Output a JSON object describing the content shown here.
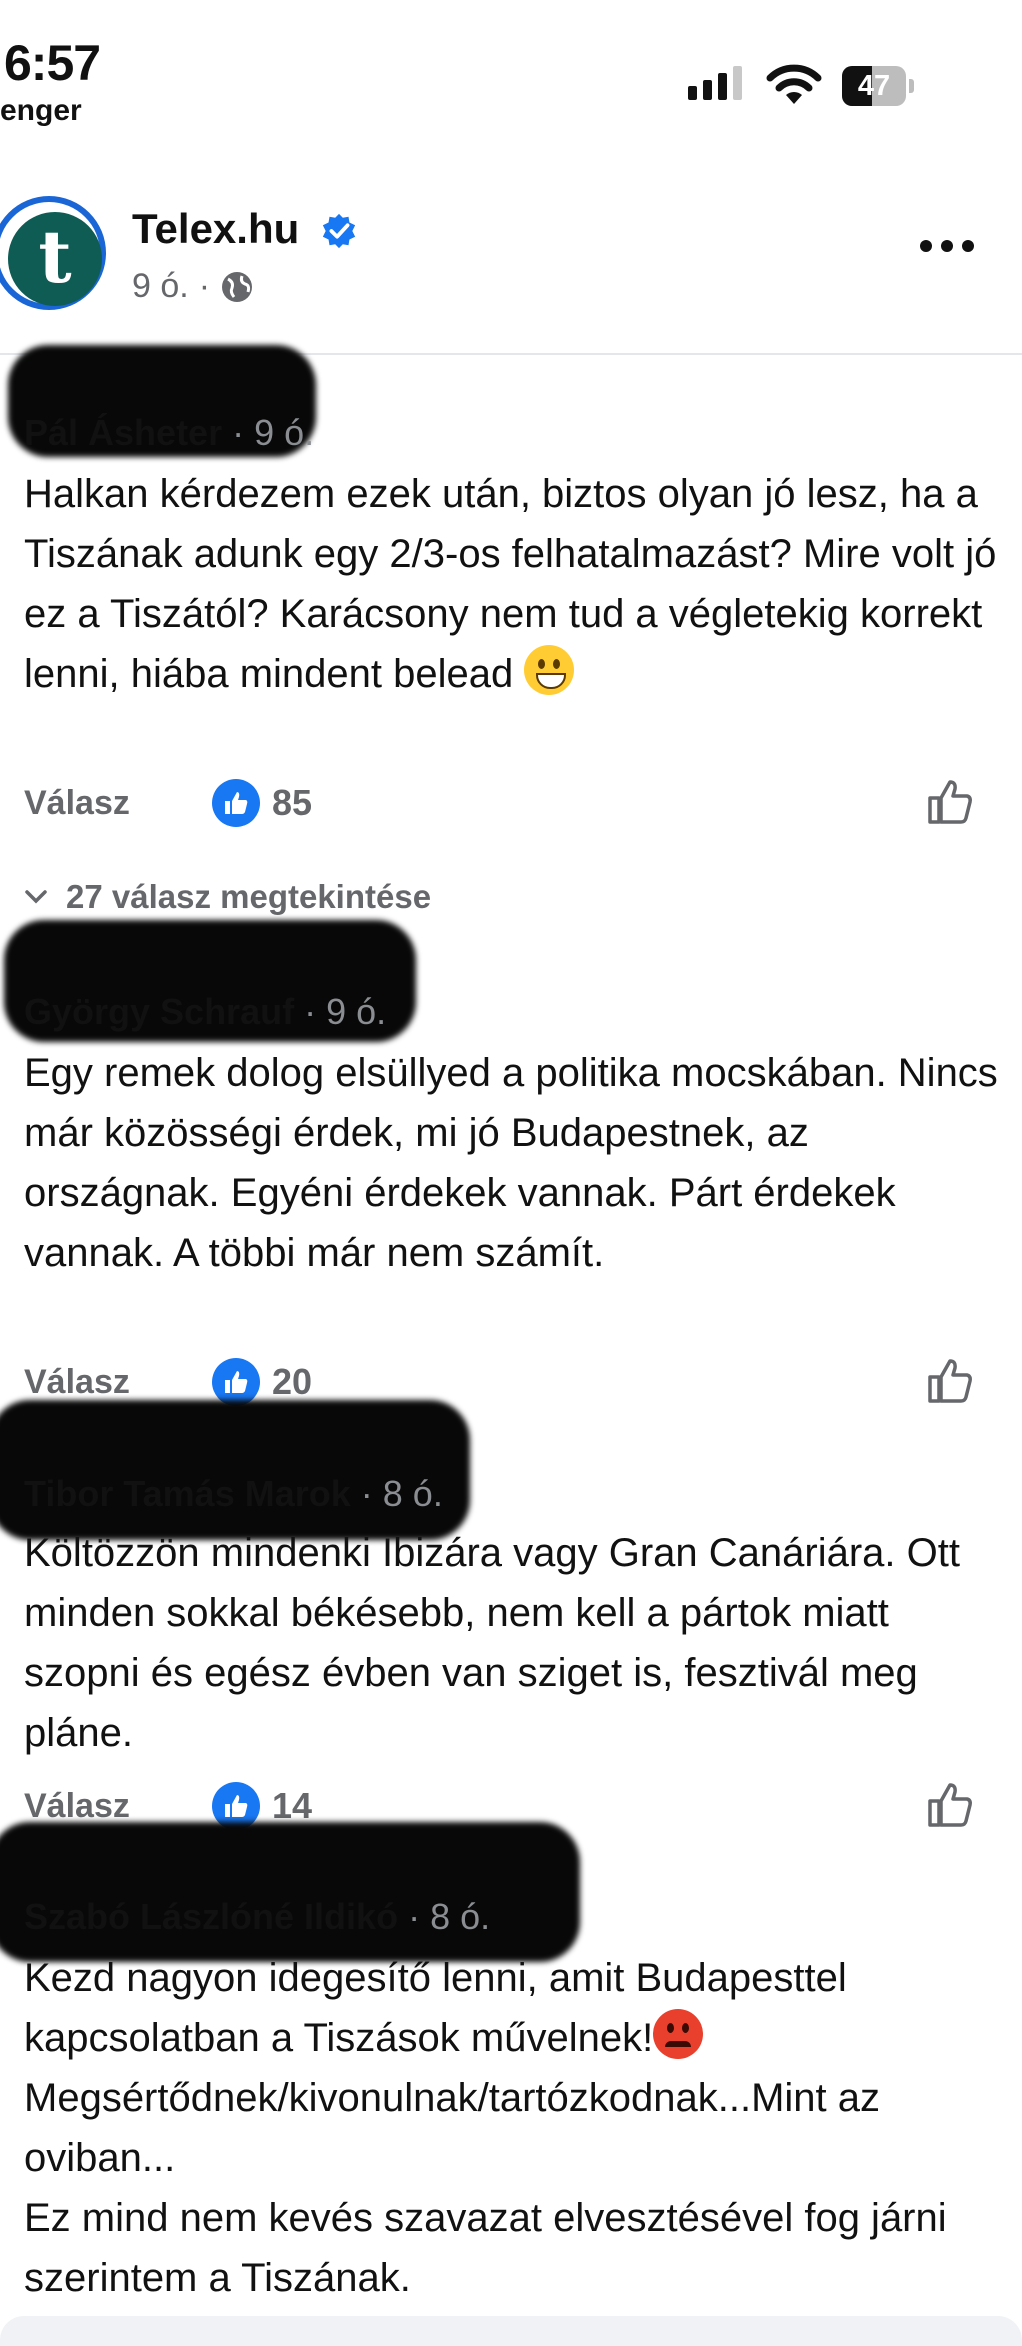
{
  "status_bar": {
    "time": "6:57",
    "back_app": "enger",
    "battery": "47",
    "battery_level": 0.47,
    "signal_bars_active": 3
  },
  "post": {
    "page_name": "Telex.hu",
    "avatar_letter": "t",
    "time": "9 ó.",
    "separator": "·",
    "audience_icon": "globe-icon",
    "verified_icon": "verified-badge-icon",
    "more_icon": "more-dots-icon"
  },
  "comments": [
    {
      "author": "Pál Ásheter",
      "time": "· 9 ó.",
      "text": "Halkan kérdezem ezek után, biztos olyan jó lesz, ha a Tiszának adunk egy 2/3-os felhatalmazást? Mire volt jó ez a Tiszától? Karácsony nem tud a végletekig korrekt lenni, hiába mindent belead",
      "emoji": "grinning-face-emoji",
      "reply_label": "Válasz",
      "likes": "85"
    },
    {
      "author": "György Schrauf",
      "time": "· 9 ó.",
      "text": "Egy remek dolog elsüllyed a politika mocskában. Nincs már közösségi érdek, mi jó Budapestnek, az országnak. Egyéni érdekek vannak. Párt érdekek vannak. A többi már nem számít.",
      "reply_label": "Válasz",
      "likes": "20"
    },
    {
      "author": "Tibor Tamás Marok",
      "time": "· 8 ó.",
      "text": "Költözzön mindenki Ibizára vagy Gran Canáriára. Ott minden sokkal békésebb, nem kell a pártok miatt szopni és egész évben van sziget is, fesztivál meg pláne.",
      "reply_label": "Válasz",
      "likes": "14"
    },
    {
      "author": "Szabó Lászlóné Ildikó",
      "time": "· 8 ó.",
      "text_part1": "Kezd nagyon idegesítő lenni, amit Budapesttel kapcsolatban a Tiszások művelnek!",
      "emoji": "angry-face-emoji",
      "text_part2": "Megsértődnek/kivonulnak/tartózkodnak...Mint az oviban...\nEz mind nem kevés szavazat elvesztésével fog járni szerintem a Tiszának."
    }
  ],
  "view_replies": "27 válasz megtekintése",
  "colors": {
    "like_blue": "#1877f2",
    "secondary_text": "#65676b",
    "avatar_green": "#0f5c55",
    "verified_blue": "#1877f2"
  }
}
